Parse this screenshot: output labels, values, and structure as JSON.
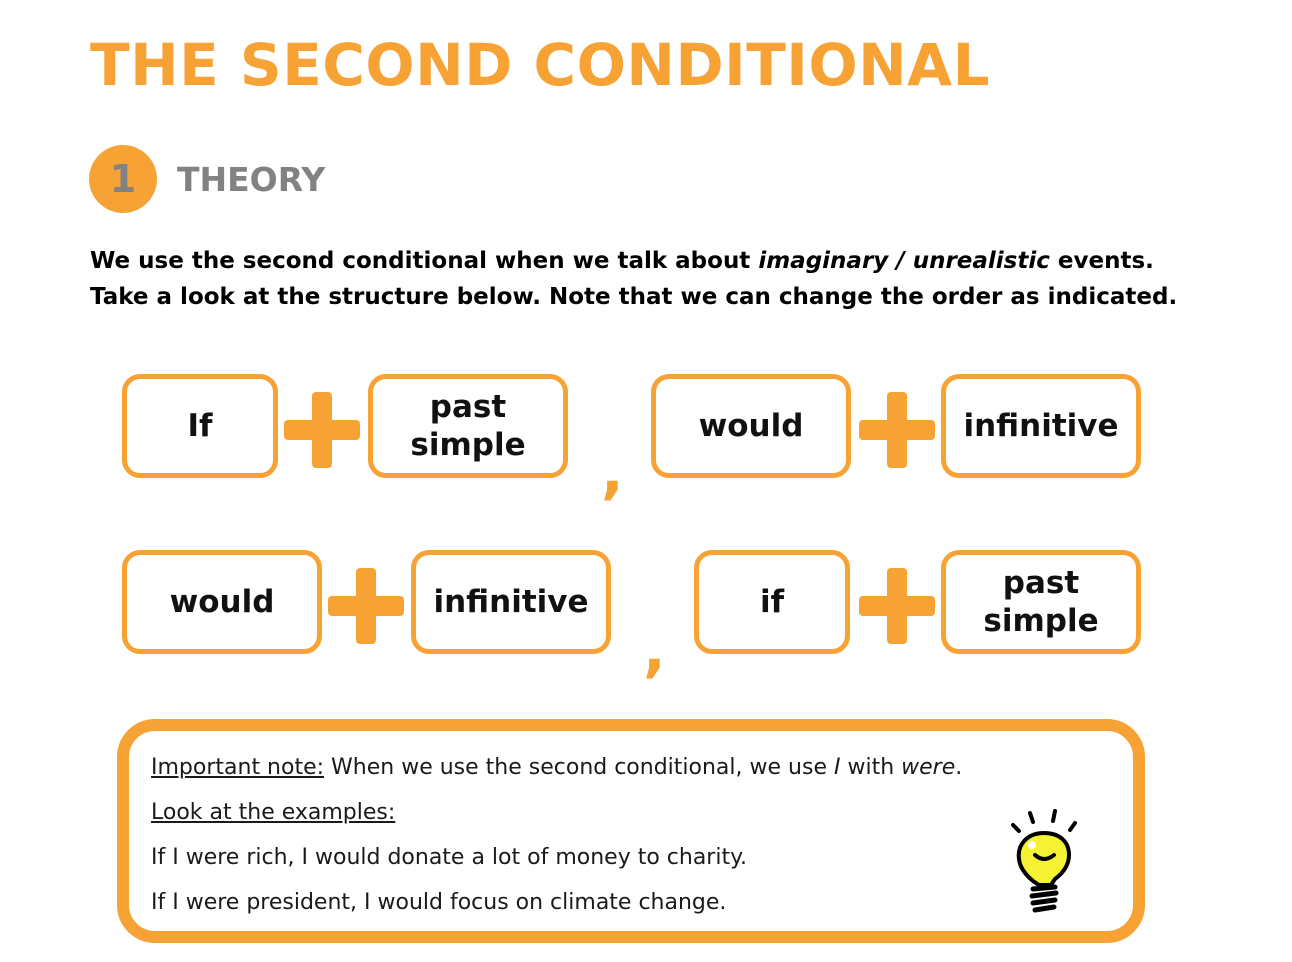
{
  "page": {
    "title": "THE SECOND CONDITIONAL"
  },
  "section": {
    "number": "1",
    "label": "THEORY"
  },
  "intro": {
    "part1": "We use the second conditional when we talk about ",
    "italic1": "imaginary / unrealistic",
    "part2": " events. Take a look at the structure below. Note that we can change the order as indicated."
  },
  "structure": {
    "row1": {
      "box1": [
        "If"
      ],
      "box2": [
        "past",
        "simple"
      ],
      "comma": ",",
      "box3": [
        "would"
      ],
      "box4": [
        "infinitive"
      ]
    },
    "row2": {
      "box1": [
        "would"
      ],
      "box2": [
        "infinitive"
      ],
      "comma": ",",
      "box3": [
        "if"
      ],
      "box4": [
        "past",
        "simple"
      ]
    },
    "plus_icon": "plus-icon"
  },
  "note": {
    "heading": "Important note:",
    "text_pre": " When we use the second conditional, we use ",
    "italic_I": "I",
    "text_mid": " with ",
    "italic_were": "were",
    "text_end": ".",
    "examples_heading": "Look at the examples:",
    "examples": [
      "If I were rich, I would donate a lot of money to charity.",
      "If I were president, I would focus on climate change."
    ],
    "icon": "lightbulb-icon"
  },
  "colors": {
    "accent": "#f7a234",
    "section_text": "#828282",
    "bulb_fill": "#f5f233"
  }
}
